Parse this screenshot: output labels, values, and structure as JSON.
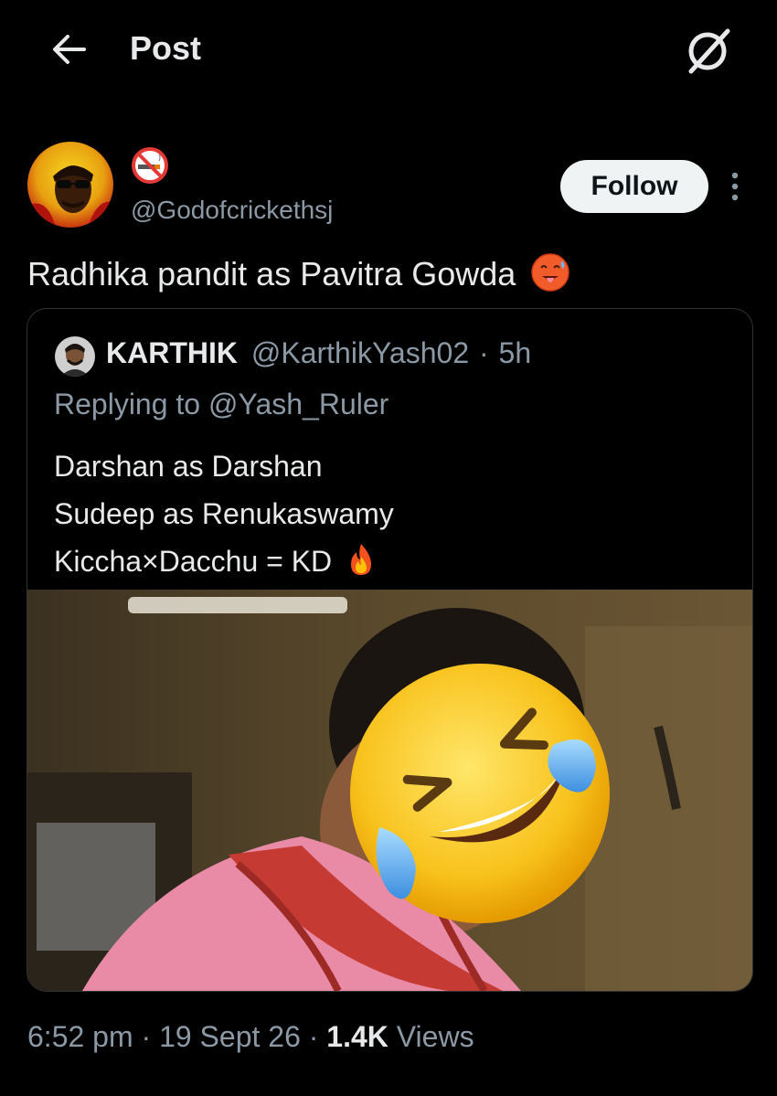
{
  "header": {
    "title": "Post"
  },
  "post": {
    "author_handle": "@Godofcrickethsj",
    "follow_label": "Follow",
    "text": "Radhika pandit as Pavitra Gowda"
  },
  "quote": {
    "name": "KARTHIK",
    "handle": "@KarthikYash02",
    "time": "5h",
    "reply_prefix": "Replying to",
    "reply_to": "@Yash_Ruler",
    "lines": [
      "Darshan as Darshan",
      "Sudeep as Renukaswamy",
      "Kiccha×Dacchu = KD"
    ]
  },
  "footer": {
    "time": "6:52 pm",
    "date": "19 Sept 26",
    "views_count": "1.4K",
    "views_label": "Views"
  },
  "colors": {
    "background": "#000000",
    "text": "#e7e9ea",
    "muted": "#8b98a5",
    "border": "#2f3336",
    "follow_bg": "#eff3f4"
  },
  "icons": {
    "back": "arrow-left-icon",
    "grok": "grok-icon",
    "more": "more-vertical-icon",
    "name_emoji": "no-smoking-icon",
    "post_emoji": "hot-face-emoji",
    "quote_emoji": "fire-emoji",
    "media_overlay": "rolling-laughing-emoji"
  }
}
